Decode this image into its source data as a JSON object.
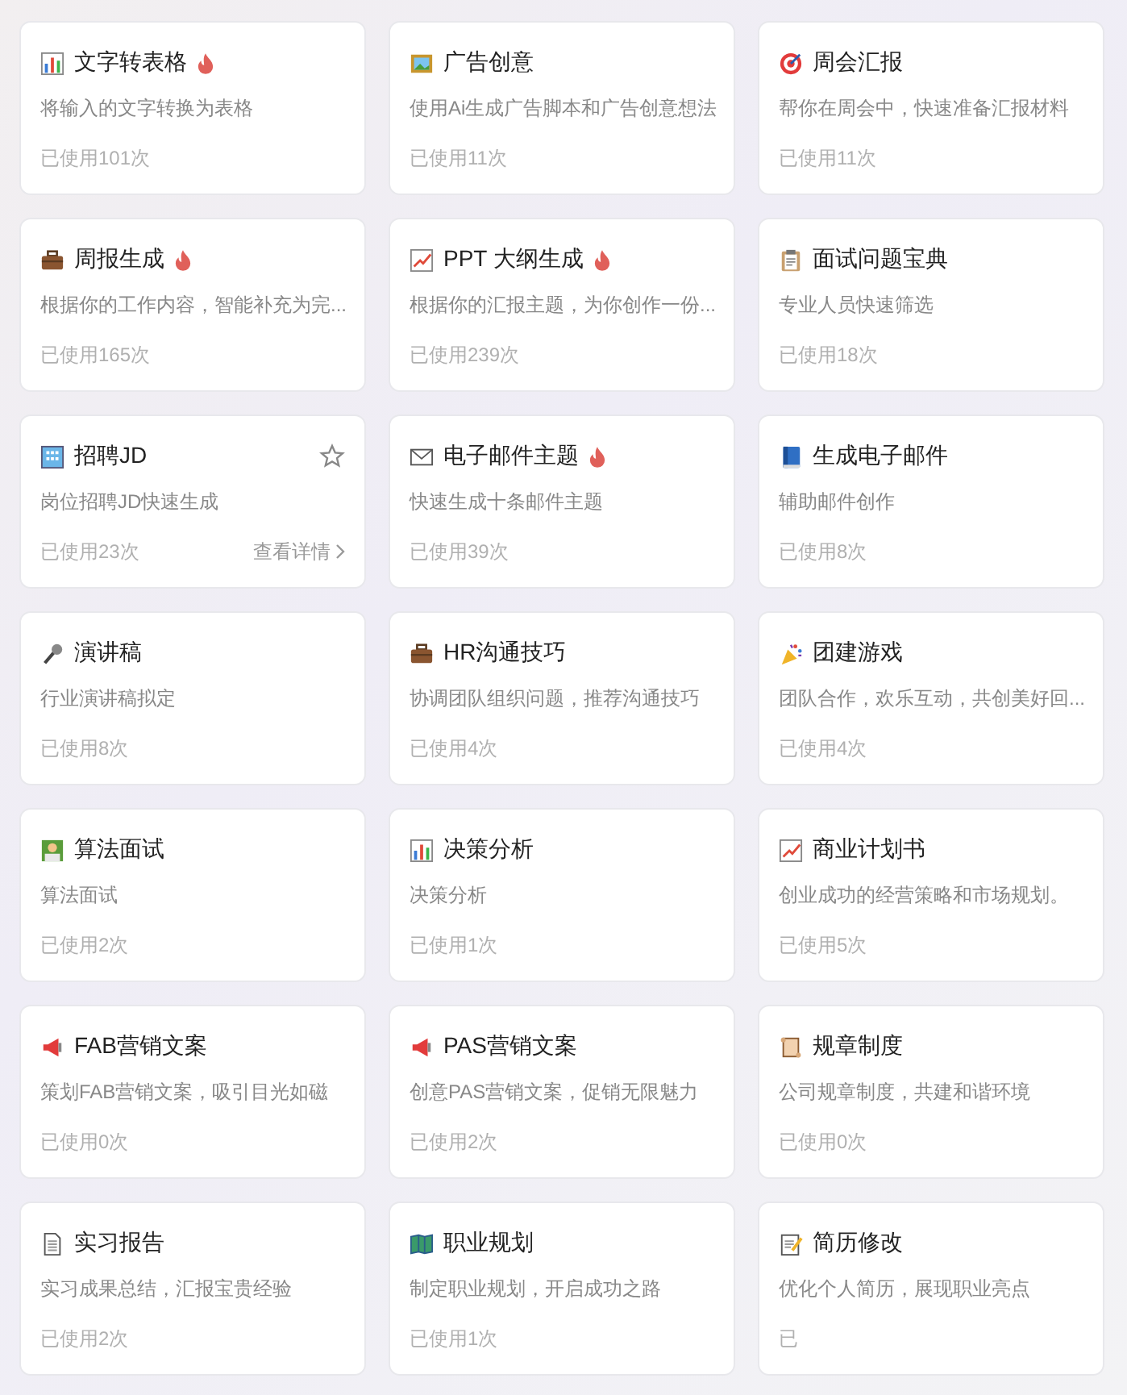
{
  "cards": [
    {
      "kind": "bar-chart",
      "title": "文字转表格",
      "hot": true,
      "description": "将输入的文字转换为表格",
      "usage": "已使用101次"
    },
    {
      "kind": "framed-picture",
      "title": "广告创意",
      "hot": false,
      "description": "使用Ai生成广告脚本和广告创意想法",
      "usage": "已使用11次"
    },
    {
      "kind": "target",
      "title": "周会汇报",
      "hot": false,
      "description": "帮你在周会中，快速准备汇报材料",
      "usage": "已使用11次"
    },
    {
      "kind": "briefcase",
      "title": "周报生成",
      "hot": true,
      "description": "根据你的工作内容，智能补充为完...",
      "usage": "已使用165次"
    },
    {
      "kind": "trend-chart",
      "title": "PPT 大纲生成",
      "hot": true,
      "description": "根据你的汇报主题，为你创作一份...",
      "usage": "已使用239次"
    },
    {
      "kind": "clipboard",
      "title": "面试问题宝典",
      "hot": false,
      "description": "专业人员快速筛选",
      "usage": "已使用18次"
    },
    {
      "kind": "building",
      "title": "招聘JD",
      "hot": false,
      "description": "岗位招聘JD快速生成",
      "usage": "已使用23次",
      "action": {
        "label": "查看详情",
        "starred": false
      }
    },
    {
      "kind": "envelope",
      "title": "电子邮件主题",
      "hot": true,
      "description": "快速生成十条邮件主题",
      "usage": "已使用39次"
    },
    {
      "kind": "book",
      "title": "生成电子邮件",
      "hot": false,
      "description": "辅助邮件创作",
      "usage": "已使用8次"
    },
    {
      "kind": "microphone",
      "title": "演讲稿",
      "hot": false,
      "description": "行业演讲稿拟定",
      "usage": "已使用8次"
    },
    {
      "kind": "briefcase",
      "title": "HR沟通技巧",
      "hot": false,
      "description": "协调团队组织问题，推荐沟通技巧",
      "usage": "已使用4次"
    },
    {
      "kind": "party-popper",
      "title": "团建游戏",
      "hot": false,
      "description": "团队合作，欢乐互动，共创美好回...",
      "usage": "已使用4次"
    },
    {
      "kind": "person-screen",
      "title": "算法面试",
      "hot": false,
      "description": "算法面试",
      "usage": "已使用2次"
    },
    {
      "kind": "bar-chart",
      "title": "决策分析",
      "hot": false,
      "description": "决策分析",
      "usage": "已使用1次"
    },
    {
      "kind": "trend-chart",
      "title": "商业计划书",
      "hot": false,
      "description": "创业成功的经营策略和市场规划。",
      "usage": "已使用5次"
    },
    {
      "kind": "megaphone",
      "title": "FAB营销文案",
      "hot": false,
      "description": "策划FAB营销文案，吸引目光如磁",
      "usage": "已使用0次"
    },
    {
      "kind": "megaphone",
      "title": "PAS营销文案",
      "hot": false,
      "description": "创意PAS营销文案，促销无限魅力",
      "usage": "已使用2次"
    },
    {
      "kind": "scroll",
      "title": "规章制度",
      "hot": false,
      "description": "公司规章制度，共建和谐环境",
      "usage": "已使用0次"
    },
    {
      "kind": "document",
      "title": "实习报告",
      "hot": false,
      "description": "实习成果总结，汇报宝贵经验",
      "usage": "已使用2次"
    },
    {
      "kind": "map",
      "title": "职业规划",
      "hot": false,
      "description": "制定职业规划，开启成功之路",
      "usage": "已使用1次"
    },
    {
      "kind": "memo",
      "title": "简历修改",
      "hot": false,
      "description": "优化个人简历，展现职业亮点",
      "usage": "已"
    }
  ]
}
